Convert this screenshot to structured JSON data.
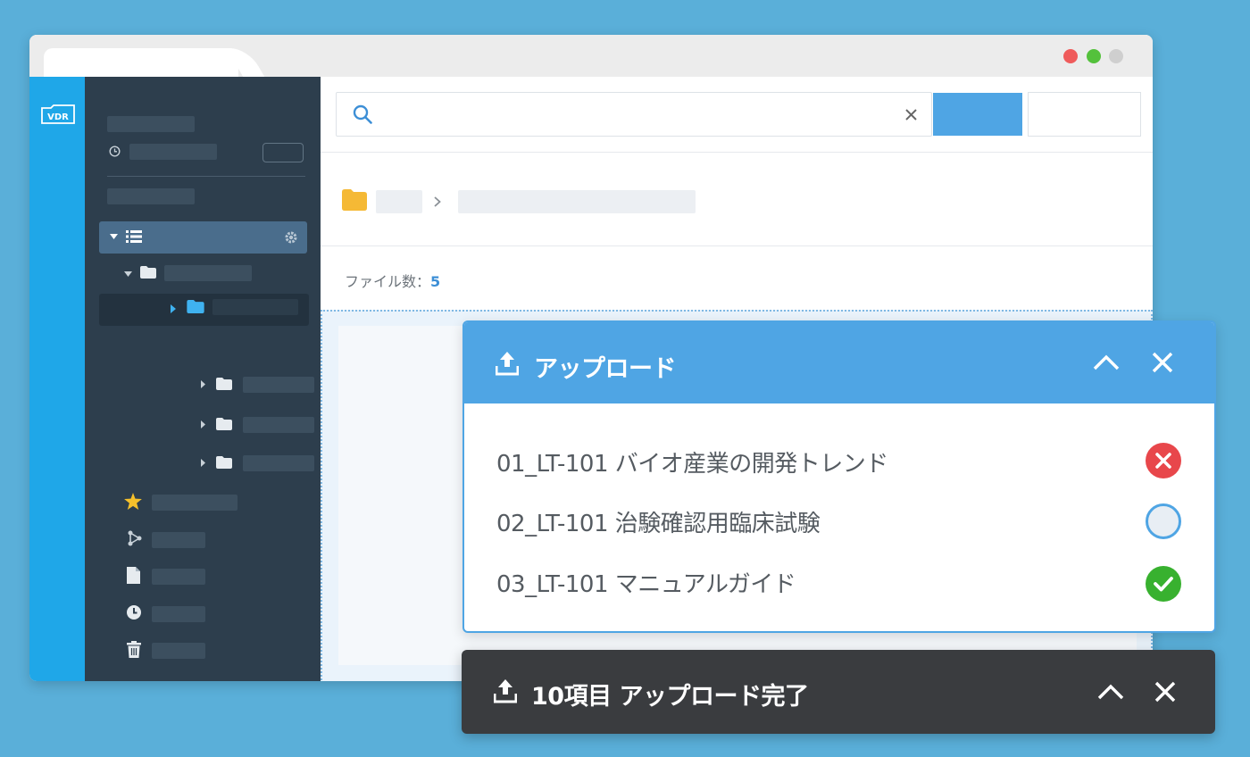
{
  "search": {
    "placeholder": "",
    "value": ""
  },
  "content": {
    "file_count_label": "ファイル数：",
    "file_count_value": "5"
  },
  "upload_panel": {
    "title": "アップロード",
    "items": [
      {
        "name": "01_LT-101 バイオ産業の開発トレンド",
        "status": "error"
      },
      {
        "name": "02_LT-101 治験確認用臨床試験",
        "status": "pending"
      },
      {
        "name": "03_LT-101 マニュアルガイド",
        "status": "complete"
      }
    ]
  },
  "complete_bar": {
    "title": "10項目 アップロード完了"
  },
  "colors": {
    "background": "#5aafd9",
    "rail": "#1fa7e8",
    "sidebar": "#2d3e4d",
    "accent": "#4fa5e4",
    "error": "#e8474b",
    "success": "#38b12f",
    "folder": "#f5b935",
    "star": "#f5c02b",
    "dark_bar": "#3a3c3f"
  },
  "icons": {
    "logo": "vdr-logo-icon",
    "search": "search-icon",
    "clear": "close-icon",
    "folder": "folder-icon",
    "chevron": "chevron-right-icon",
    "upload": "upload-icon",
    "collapse": "chevron-up-icon",
    "close": "close-icon",
    "error": "error-circle-icon",
    "pending": "pending-circle-icon",
    "complete": "check-circle-icon"
  }
}
